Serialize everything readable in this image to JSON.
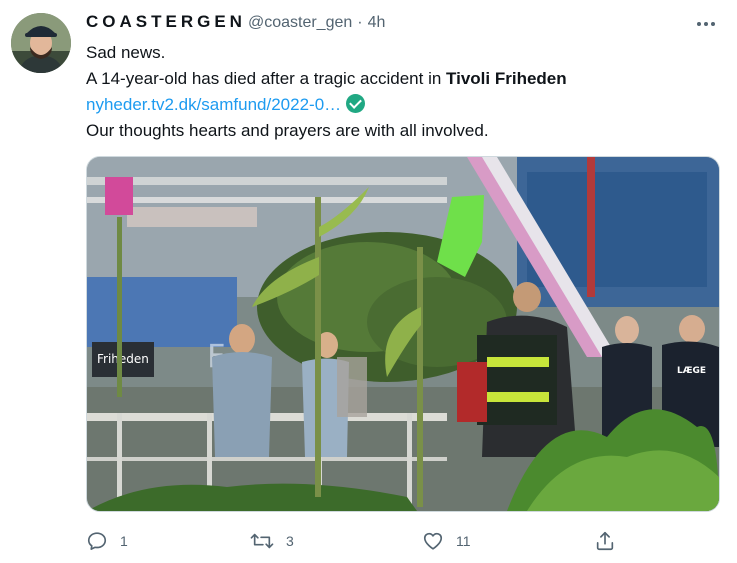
{
  "tweet": {
    "display_name": "COASTERGEN",
    "handle": "@coaster_gen",
    "separator": "·",
    "time": "4h",
    "lines": {
      "l1": "Sad news.",
      "l2_prefix": "A 14-year-old has died after a tragic accident in ",
      "l2_bold": "Tivoli Friheden",
      "link": "nyheder.tv2.dk/samfund/2022-0…",
      "l4": "Our thoughts hearts and prayers are with all involved."
    },
    "media": {
      "sign_text": "Friheden",
      "sign_text_top": "F",
      "vest_text": "LÆGE"
    },
    "actions": {
      "reply_count": "1",
      "retweet_count": "3",
      "like_count": "11"
    }
  },
  "colors": {
    "link": "#1d9bf0",
    "verified": "#20a883",
    "secondary_text": "#536471"
  }
}
